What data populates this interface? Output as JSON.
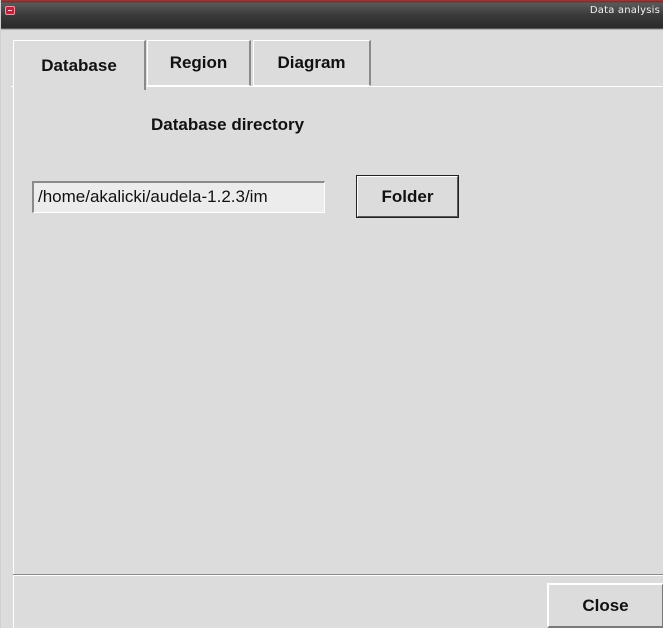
{
  "window": {
    "title": "Data analysis"
  },
  "tabs": [
    {
      "label": "Database",
      "active": true
    },
    {
      "label": "Region",
      "active": false
    },
    {
      "label": "Diagram",
      "active": false
    }
  ],
  "database_panel": {
    "section_title": "Database directory",
    "directory_value": "/home/akalicki/audela-1.2.3/im",
    "folder_button_label": "Folder"
  },
  "footer": {
    "close_label": "Close"
  },
  "colors": {
    "window_bg": "#dcdcdc",
    "titlebar_bg": "#2a2a2a",
    "titlebar_text": "#f0f0f0",
    "menu_button": "#b7263d"
  },
  "icons": {
    "window_menu": "window-menu-icon"
  }
}
